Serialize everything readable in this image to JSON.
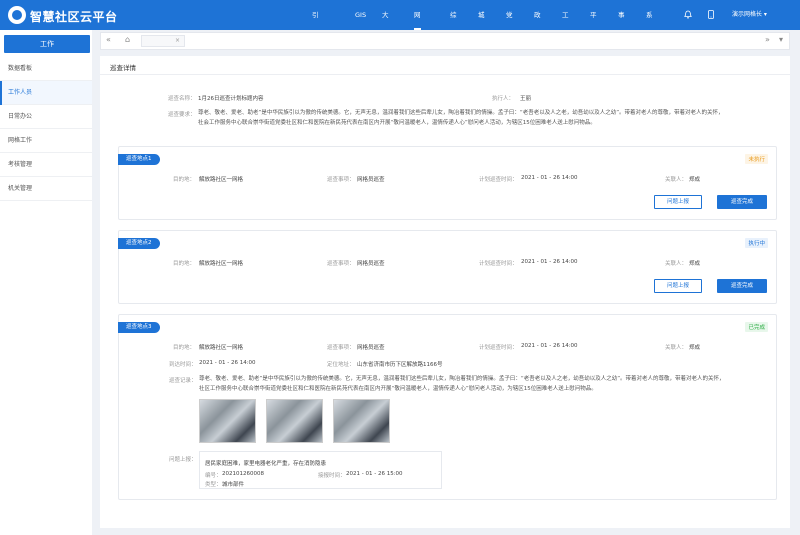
{
  "app": {
    "title": "智慧社区云平台",
    "user": "演示网格长 ▾"
  },
  "nav": [
    "引导页",
    "GIS",
    "大数据",
    "网格化",
    "综治",
    "城管",
    "党建",
    "政务",
    "工作",
    "平安",
    "事件",
    "系统"
  ],
  "nav_active": "网格化",
  "sidebar": {
    "header": "工作",
    "items": [
      "数据看板",
      "工作人员",
      "日常办公",
      "网格工作",
      "考核管理",
      "机关管理"
    ],
    "active": "工作人员"
  },
  "tabs": {
    "left_icon": "«",
    "right_icon": "»",
    "home_icon": "⌂",
    "close_icon": "×"
  },
  "panel": {
    "title": "巡查详情",
    "name_label": "巡查名称：",
    "name_value": "1月26日巡查计划标题内容",
    "executor_label": "执行人：",
    "executor_value": "王丽",
    "req_label": "巡查要求：",
    "req_text_1": "尊老、敬老、爱老、助老”是中华民族引以为傲的传统美德。它，无声无息，温润着我们这些后辈儿女，陶冶着我们的情操。孟子曰：“老吾老以及人之老，幼吾幼以及人之幼”。带着对老人的尊敬，带着对老人的关怀，",
    "req_text_2": "社会工作服务中心联合崇华街道党委社区和仁和医院在新民苑代表在南区内开展“敬问温暖老人，温情传递人心”慰问老人活动，为辖区15位困难老人送上慰问物品。"
  },
  "cards": [
    {
      "tag": "巡查地点1",
      "status": "未执行",
      "dest_label": "目的地：",
      "dest": "解放路社区一网格",
      "item_label": "巡查事项：",
      "item": "网格员巡查",
      "time_label": "计划巡查时间：",
      "time": "2021 - 01 - 26  14:00",
      "contact_label": "关联人：",
      "contact": "郑成",
      "btn_report": "问题上报",
      "btn_done": "巡查完成"
    },
    {
      "tag": "巡查地点2",
      "status": "执行中",
      "dest_label": "目的地：",
      "dest": "解放路社区一网格",
      "item_label": "巡查事项：",
      "item": "网格员巡查",
      "time_label": "计划巡查时间：",
      "time": "2021 - 01 - 26  14:00",
      "contact_label": "关联人：",
      "contact": "郑成",
      "btn_report": "问题上报",
      "btn_done": "巡查完成"
    },
    {
      "tag": "巡查地点3",
      "status": "已完成",
      "dest_label": "目的地：",
      "dest": "解放路社区一网格",
      "item_label": "巡查事项：",
      "item": "网格员巡查",
      "time_label": "计划巡查时间：",
      "time": "2021 - 01 - 26  14:00",
      "contact_label": "关联人：",
      "contact": "郑成",
      "arrive_label": "到达时间：",
      "arrive": "2021 - 01 - 26  14:00",
      "loc_label": "定位地址：",
      "loc": "山东省济南市历下区解放路1166号",
      "record_label": "巡查记录：",
      "record_1": "尊老、敬老、爱老、助老”是中华民族引以为傲的传统美德。它，无声无息，温润着我们这些后辈儿女，陶冶着我们的情操。孟子曰：“老吾老以及人之老，幼吾幼以及人之幼”。带着对老人的尊敬，带着对老人的关怀，",
      "record_2": "社区工作服务中心联合崇华街道党委社区和仁和医院在新民苑代表在南区内开展“敬问温暖老人，温情传递人心”慰问老人活动，为辖区15位困难老人送上慰问物品。",
      "issue_label": "问题上报：",
      "issue_title": "居民家庭困难，家里电器老化严重，存在消防隐患",
      "issue_no_label": "编号：",
      "issue_no": "202101260008",
      "issue_time_label": "接报时间：",
      "issue_time": "2021 - 01 - 26  15:00",
      "issue_type_label": "类型：",
      "issue_type": "城市部件"
    }
  ]
}
